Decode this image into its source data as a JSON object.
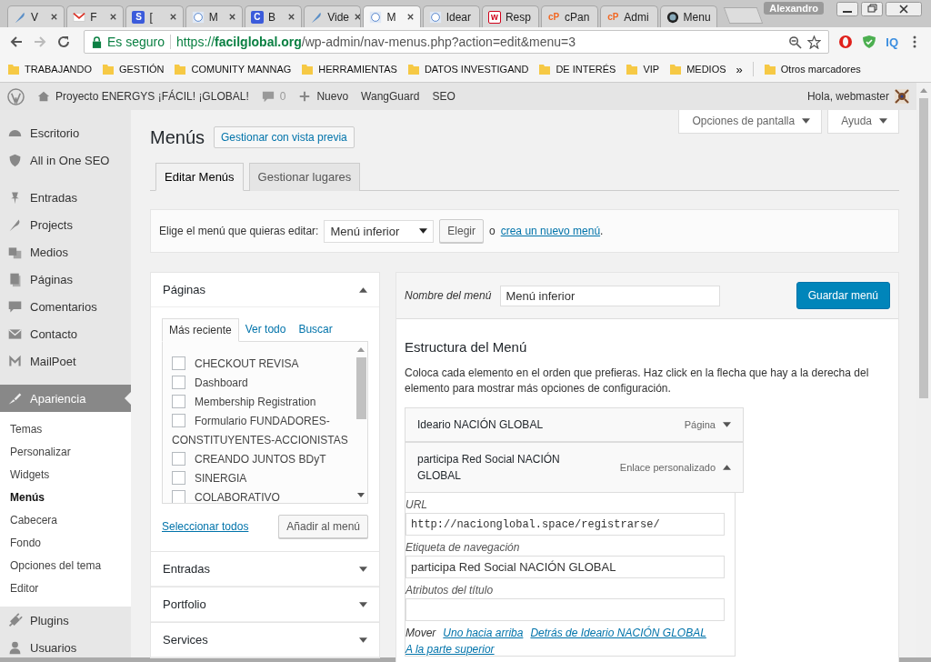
{
  "browser": {
    "tabs": [
      {
        "title": "V",
        "kind": "feather",
        "selected": false
      },
      {
        "title": "F",
        "kind": "mail",
        "selected": false
      },
      {
        "title": "[",
        "kind": "letter",
        "icon_text": "S",
        "selected": false
      },
      {
        "title": "M",
        "kind": "globe",
        "selected": false
      },
      {
        "title": "B",
        "kind": "letter",
        "icon_text": "C",
        "selected": false
      },
      {
        "title": "Vide",
        "kind": "feather",
        "selected": false
      },
      {
        "title": "M",
        "kind": "globe",
        "selected": true
      },
      {
        "title": "Idear",
        "kind": "globe",
        "selected": false
      },
      {
        "title": "Resp",
        "kind": "wlogo",
        "icon_text": "w",
        "selected": false
      },
      {
        "title": "cPan",
        "kind": "cpanel",
        "icon_text": "cP",
        "selected": false
      },
      {
        "title": "Admi",
        "kind": "cpanel",
        "icon_text": "cP",
        "selected": false
      },
      {
        "title": "Menu",
        "kind": "ring",
        "selected": false
      }
    ],
    "profile": "Alexandro",
    "security": "Es seguro",
    "url": {
      "scheme": "https://",
      "host": "facilglobal.org",
      "path": "/wp-admin/nav-menus.php?action=edit&menu=3"
    },
    "extension_label": "IQ",
    "bookmarks": [
      "TRABAJANDO",
      "GESTIÓN",
      "COMUNITY MANNAG",
      "HERRAMIENTAS",
      "DATOS INVESTIGAND",
      "DE INTERÉS",
      "VIP",
      "MEDIOS"
    ],
    "more": "»",
    "other_bookmarks": "Otros marcadores"
  },
  "admin_bar": {
    "site": "Proyecto ENERGYS ¡FÁCIL! ¡GLOBAL!",
    "comments": "0",
    "new": "Nuevo",
    "items": [
      "WangGuard",
      "SEO"
    ],
    "greeting": "Hola, webmaster"
  },
  "sidebar": {
    "groups": [
      [
        {
          "label": "Escritorio",
          "kind": "gauge",
          "selected": false
        },
        {
          "label": "All in One SEO",
          "kind": "shield",
          "selected": false
        }
      ],
      [
        {
          "label": "Entradas",
          "kind": "pin",
          "selected": false
        },
        {
          "label": "Projects",
          "kind": "feather",
          "selected": false
        },
        {
          "label": "Medios",
          "kind": "media",
          "selected": false
        },
        {
          "label": "Páginas",
          "kind": "page",
          "selected": false
        },
        {
          "label": "Comentarios",
          "kind": "bubble",
          "selected": false
        },
        {
          "label": "Contacto",
          "kind": "mail",
          "selected": false
        },
        {
          "label": "MailPoet",
          "kind": "mletter",
          "selected": false
        }
      ],
      [
        {
          "label": "Apariencia",
          "kind": "brush",
          "selected": true,
          "children": [
            {
              "label": "Temas",
              "selected": false
            },
            {
              "label": "Personalizar",
              "selected": false
            },
            {
              "label": "Widgets",
              "selected": false
            },
            {
              "label": "Menús",
              "selected": true
            },
            {
              "label": "Cabecera",
              "selected": false
            },
            {
              "label": "Fondo",
              "selected": false
            },
            {
              "label": "Opciones del tema",
              "selected": false
            },
            {
              "label": "Editor",
              "selected": false
            }
          ]
        },
        {
          "label": "Plugins",
          "kind": "plug",
          "selected": false
        },
        {
          "label": "Usuarios",
          "kind": "user",
          "selected": false
        }
      ]
    ]
  },
  "page": {
    "title": "Menús",
    "preview_button": "Gestionar con vista previa",
    "screen_options": "Opciones de pantalla",
    "help": "Ayuda",
    "tabs": [
      {
        "label": "Editar Menús",
        "selected": true
      },
      {
        "label": "Gestionar lugares",
        "selected": false
      }
    ],
    "select_bar": {
      "label": "Elige el menú que quieras editar:",
      "value": "Menú inferior",
      "button": "Elegir",
      "or": "o",
      "link": "crea un nuevo menú",
      "end": "."
    },
    "panels": [
      {
        "title": "Páginas",
        "expanded": true,
        "tabs": [
          {
            "label": "Más reciente",
            "selected": true
          },
          {
            "label": "Ver todo",
            "selected": false
          },
          {
            "label": "Buscar",
            "selected": false
          }
        ],
        "items": [
          {
            "label": "CHECKOUT REVISA",
            "checked": false
          },
          {
            "label": "Dashboard",
            "checked": false
          },
          {
            "label": "Membership Registration",
            "checked": false
          },
          {
            "label": "Formulario FUNDADORES-CONSTITUYENTES-ACCIONISTAS",
            "checked": false
          },
          {
            "label": "CREANDO JUNTOS BDyT",
            "checked": false
          },
          {
            "label": "SINERGIA",
            "checked": false
          },
          {
            "label": "COLABORATIVO",
            "checked": false
          }
        ],
        "select_all": "Seleccionar todos",
        "add_button": "Añadir al menú"
      },
      {
        "title": "Entradas",
        "expanded": false
      },
      {
        "title": "Portfolio",
        "expanded": false
      },
      {
        "title": "Services",
        "expanded": false
      }
    ],
    "editor": {
      "name_label": "Nombre del menú",
      "name_value": "Menú inferior",
      "save_button": "Guardar menú",
      "heading": "Estructura del Menú",
      "intro": "Coloca cada elemento en el orden que prefieras. Haz click en la flecha que hay a la derecha del elemento para mostrar más opciones de configuración.",
      "items": [
        {
          "title": "Ideario NACIÓN GLOBAL",
          "type": "Página",
          "expanded": false
        },
        {
          "title": "participa Red Social NACIÓN GLOBAL",
          "type": "Enlace personalizado",
          "expanded": true,
          "fields": [
            {
              "label": "URL",
              "kind": "url",
              "value": "http://nacionglobal.space/registrarse/"
            },
            {
              "label": "Etiqueta de navegación",
              "kind": "text",
              "value": "participa Red Social NACIÓN GLOBAL"
            },
            {
              "label": "Atributos del título",
              "kind": "text"
            }
          ],
          "move_label": "Mover",
          "move_links": [
            "Uno hacia arriba",
            "Detrás de Ideario NACIÓN GLOBAL",
            "A la parte superior"
          ]
        }
      ]
    }
  }
}
